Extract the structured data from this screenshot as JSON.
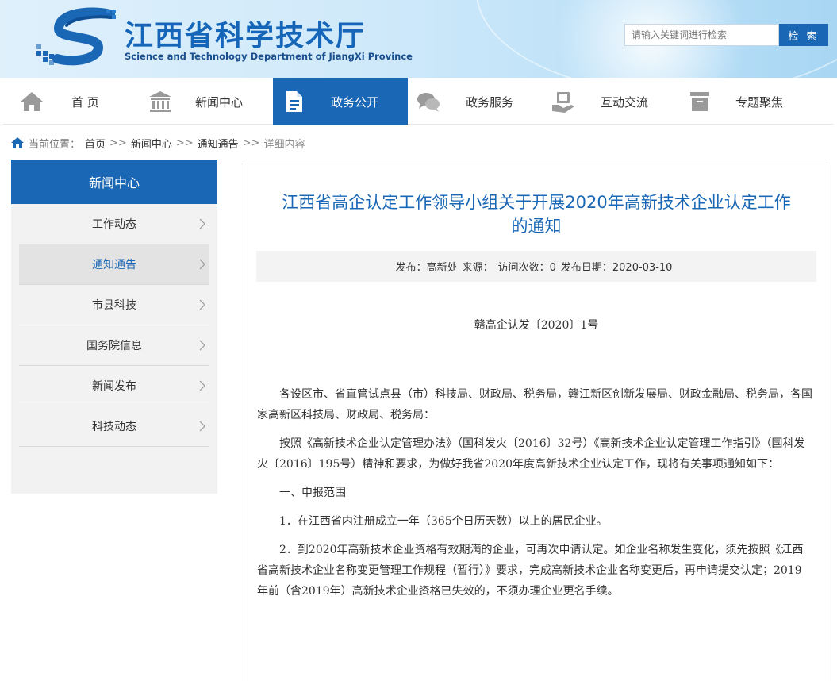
{
  "header": {
    "org_name_cn": "江西省科学技术厅",
    "org_name_en": "Science and Technology Department of JiangXi Province",
    "search_placeholder": "请输入关键词进行检索",
    "search_button": "检 索"
  },
  "nav": {
    "items": [
      {
        "label": "首 页",
        "icon": "home-icon"
      },
      {
        "label": "新闻中心",
        "icon": "building-icon"
      },
      {
        "label": "政务公开",
        "icon": "document-icon",
        "active": true
      },
      {
        "label": "政务服务",
        "icon": "chat-icon"
      },
      {
        "label": "互动交流",
        "icon": "handshake-icon"
      },
      {
        "label": "专题聚焦",
        "icon": "archive-icon"
      }
    ],
    "active_color": "#1a67b5"
  },
  "breadcrumb": {
    "prefix": "当前位置：",
    "items": [
      "首页",
      "新闻中心",
      "通知通告"
    ],
    "separator": ">>",
    "current": "详细内容"
  },
  "sidebar": {
    "title": "新闻中心",
    "items": [
      {
        "label": "工作动态"
      },
      {
        "label": "通知通告",
        "active": true
      },
      {
        "label": "市县科技"
      },
      {
        "label": "国务院信息"
      },
      {
        "label": "新闻发布"
      },
      {
        "label": "科技动态"
      }
    ]
  },
  "article": {
    "title_line1": "江西省高企认定工作领导小组关于开展2020年高新技术企业认定工作",
    "title_line2": "的通知",
    "meta": {
      "publisher": "发布：高新处",
      "source": "来源：",
      "views": "访问次数：0",
      "date": "发布日期：2020-03-10"
    },
    "doc_number": "赣高企认发〔2020〕1号",
    "paragraphs": [
      "各设区市、省直管试点县（市）科技局、财政局、税务局，赣江新区创新发展局、财政金融局、税务局，各国家高新区科技局、财政局、税务局：",
      "按照《高新技术企业认定管理办法》（国科发火〔2016〕32号）《高新技术企业认定管理工作指引》（国科发火〔2016〕195号）精神和要求，为做好我省2020年度高新技术企业认定工作，现将有关事项通知如下：",
      "一、申报范围",
      "1．在江西省内注册成立一年（365个日历天数）以上的居民企业。",
      "2．到2020年高新技术企业资格有效期满的企业，可再次申请认定。如企业名称发生变化，须先按照《江西省高新技术企业名称变更管理工作规程（暂行）》要求，完成高新技术企业名称变更后，再申请提交认定；2019年前（含2019年）高新技术企业资格已失效的，不须办理企业更名手续。"
    ]
  },
  "colors": {
    "brand_blue": "#1a67b5",
    "title_blue": "#1a67b5",
    "sidebar_bg": "#f2f2f2"
  }
}
